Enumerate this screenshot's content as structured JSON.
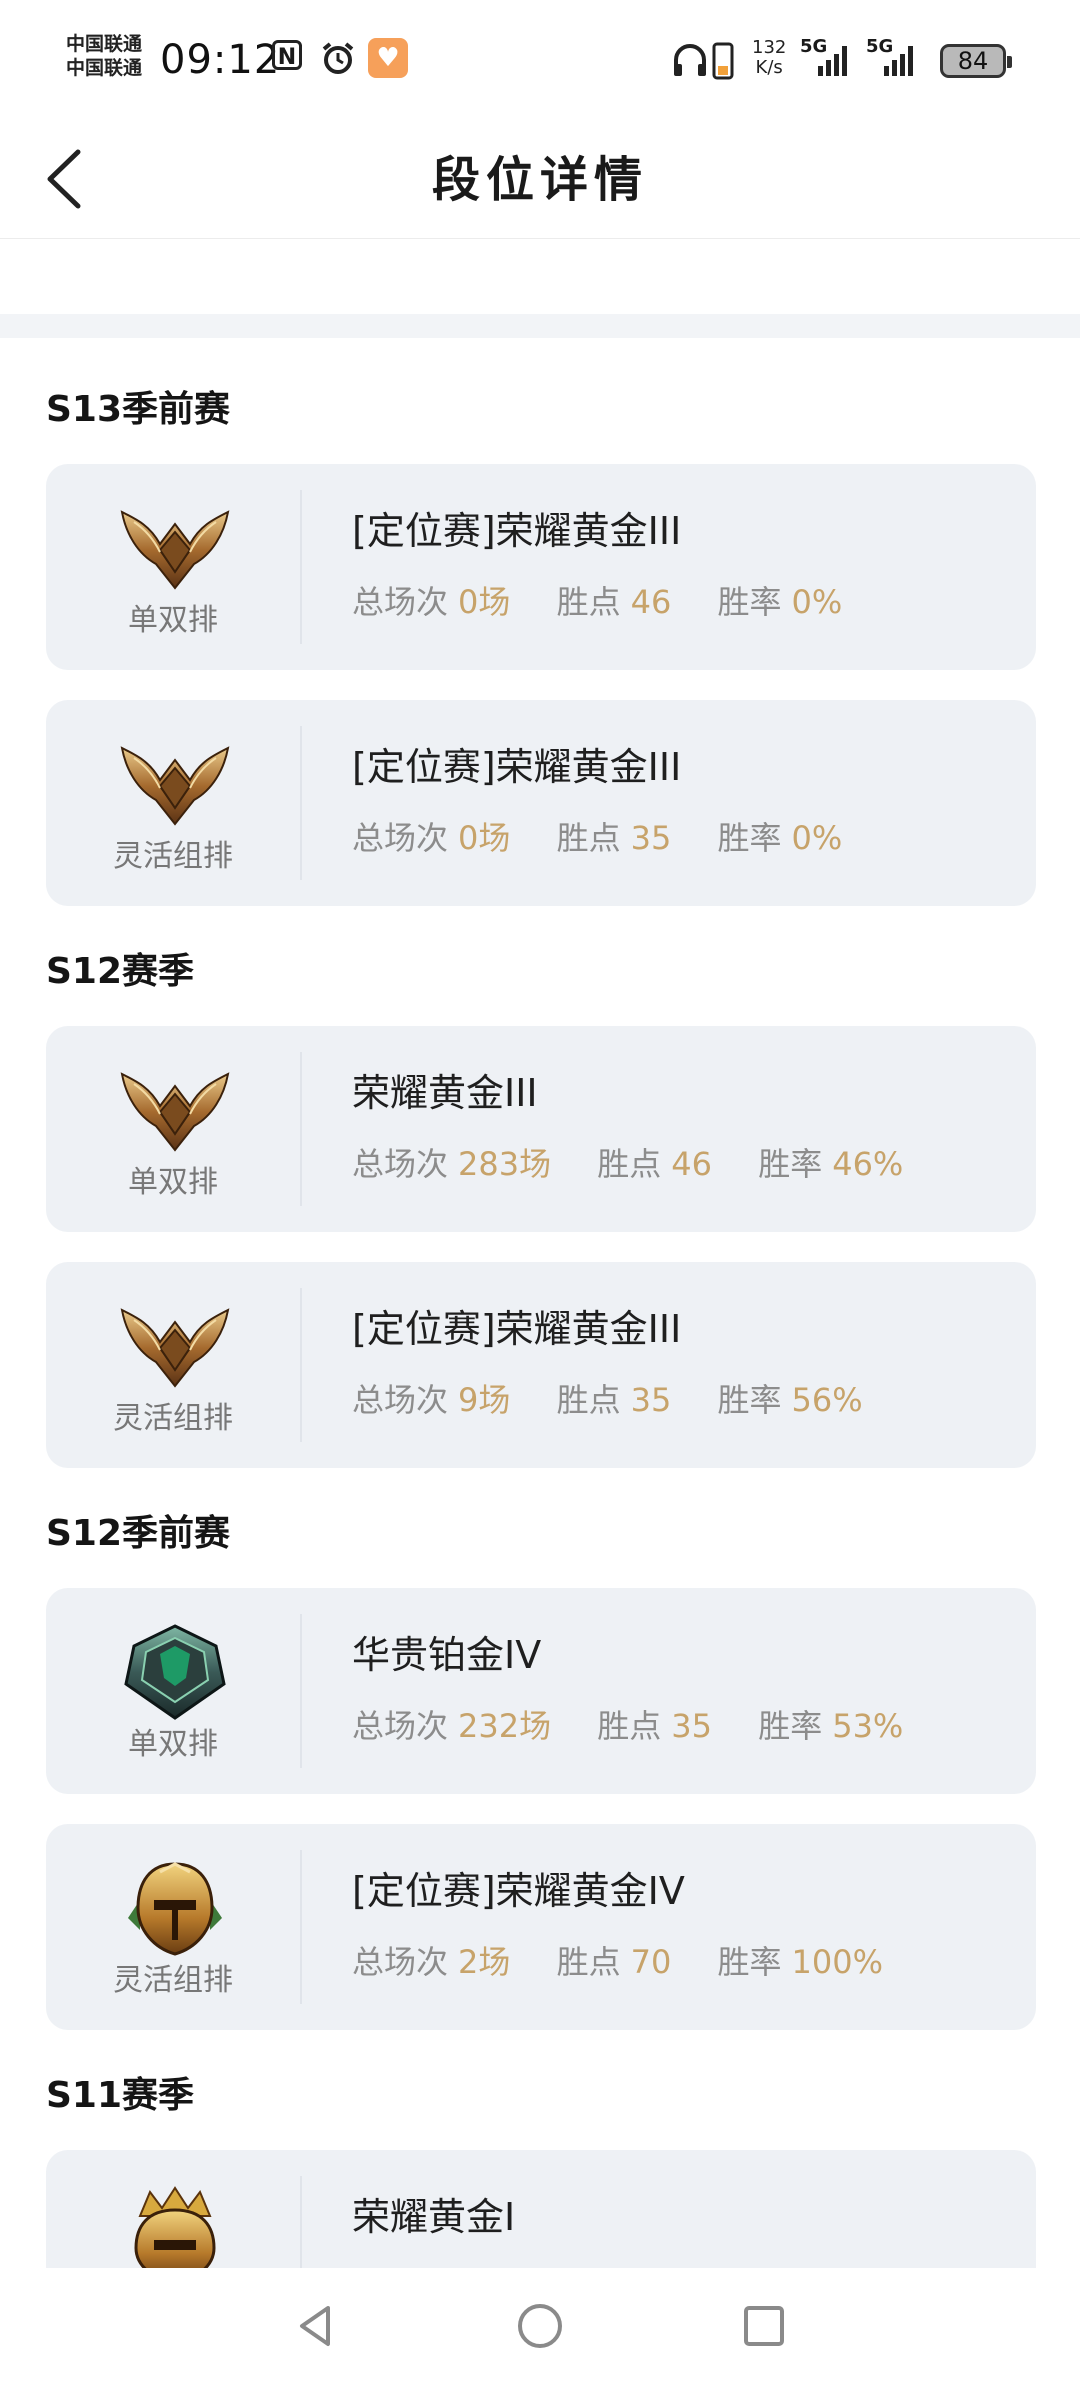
{
  "status": {
    "carrier1": "中国联通",
    "carrier2": "中国联通",
    "time": "09:12",
    "nfc": "N",
    "speed_value": "132",
    "speed_unit": "K/s",
    "net1": "5G",
    "net2": "5G",
    "battery": "84"
  },
  "header": {
    "title": "段位详情"
  },
  "labels": {
    "games": "总场次",
    "points": "胜点",
    "winrate": "胜率"
  },
  "sections": [
    {
      "title": "S13季前赛",
      "cards": [
        {
          "queue": "单双排",
          "rank": "[定位赛]荣耀黄金III",
          "games": "0场",
          "points": "46",
          "winrate": "0%",
          "emblem": "gold-wings-emblem-icon"
        },
        {
          "queue": "灵活组排",
          "rank": "[定位赛]荣耀黄金III",
          "games": "0场",
          "points": "35",
          "winrate": "0%",
          "emblem": "gold-wings-emblem-icon"
        }
      ]
    },
    {
      "title": "S12赛季",
      "cards": [
        {
          "queue": "单双排",
          "rank": "荣耀黄金III",
          "games": "283场",
          "points": "46",
          "winrate": "46%",
          "emblem": "gold-wings-emblem-icon"
        },
        {
          "queue": "灵活组排",
          "rank": "[定位赛]荣耀黄金III",
          "games": "9场",
          "points": "35",
          "winrate": "56%",
          "emblem": "gold-wings-emblem-icon"
        }
      ]
    },
    {
      "title": "S12季前赛",
      "cards": [
        {
          "queue": "单双排",
          "rank": "华贵铂金IV",
          "games": "232场",
          "points": "35",
          "winrate": "53%",
          "emblem": "platinum-emblem-icon"
        },
        {
          "queue": "灵活组排",
          "rank": "[定位赛]荣耀黄金IV",
          "games": "2场",
          "points": "70",
          "winrate": "100%",
          "emblem": "gold-helmet-emblem-icon"
        }
      ]
    },
    {
      "title": "S11赛季",
      "cards": [
        {
          "queue": "",
          "rank": "荣耀黄金I",
          "games": "",
          "points": "",
          "winrate": "",
          "emblem": "gold-crown-emblem-icon"
        }
      ]
    }
  ],
  "colors": {
    "accent_value": "#c7a36a",
    "card_bg": "#eef1f5",
    "label_gray": "#8c8c8c"
  }
}
